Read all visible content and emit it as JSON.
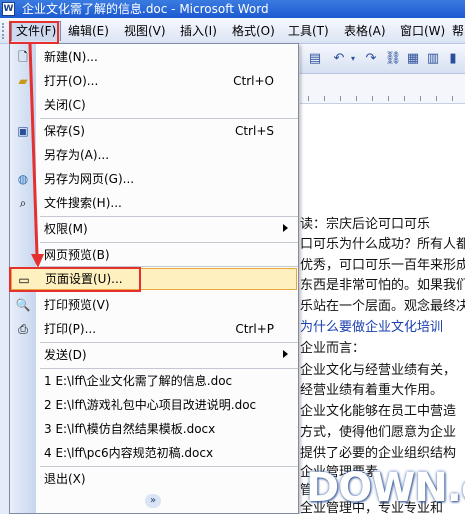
{
  "window": {
    "title": "企业文化需了解的信息.doc - Microsoft Word",
    "app_icon": "word-icon"
  },
  "menubar": [
    {
      "label": "文件(F)"
    },
    {
      "label": "编辑(E)"
    },
    {
      "label": "视图(V)"
    },
    {
      "label": "插入(I)"
    },
    {
      "label": "格式(O)"
    },
    {
      "label": "工具(T)"
    },
    {
      "label": "表格(A)"
    },
    {
      "label": "窗口(W)"
    },
    {
      "label": "帮"
    }
  ],
  "file_menu": {
    "items": [
      {
        "label": "新建(N)...",
        "shortcut": "",
        "icon": "new-doc-icon"
      },
      {
        "label": "打开(O)...",
        "shortcut": "Ctrl+O",
        "icon": "open-folder-icon"
      },
      {
        "label": "关闭(C)",
        "shortcut": "",
        "icon": ""
      },
      {
        "label": "保存(S)",
        "shortcut": "Ctrl+S",
        "icon": "save-icon"
      },
      {
        "label": "另存为(A)...",
        "shortcut": "",
        "icon": ""
      },
      {
        "label": "另存为网页(G)...",
        "shortcut": "",
        "icon": "web-page-icon"
      },
      {
        "label": "文件搜索(H)...",
        "shortcut": "",
        "icon": "file-search-icon"
      },
      {
        "label": "权限(M)",
        "shortcut": "",
        "icon": ""
      },
      {
        "label": "网页预览(B)",
        "shortcut": "",
        "icon": ""
      },
      {
        "label": "页面设置(U)...",
        "shortcut": "",
        "icon": "page-setup-icon"
      },
      {
        "label": "打印预览(V)",
        "shortcut": "",
        "icon": "print-preview-icon"
      },
      {
        "label": "打印(P)...",
        "shortcut": "Ctrl+P",
        "icon": "print-icon"
      },
      {
        "label": "发送(D)",
        "shortcut": "",
        "icon": ""
      },
      {
        "label": "1 E:\\lff\\企业文化需了解的信息.doc",
        "shortcut": "",
        "icon": ""
      },
      {
        "label": "2 E:\\lff\\游戏礼包中心项目改进说明.doc",
        "shortcut": "",
        "icon": ""
      },
      {
        "label": "3 E:\\lff\\模仿自然结果模板.docx",
        "shortcut": "",
        "icon": ""
      },
      {
        "label": "4 E:\\lff\\pc6内容规范初稿.docx",
        "shortcut": "",
        "icon": ""
      },
      {
        "label": "退出(X)",
        "shortcut": "",
        "icon": ""
      }
    ],
    "expand_glyph": "»"
  },
  "document": {
    "lines": [
      "读：宗庆后论可口可乐",
      "口可乐为什么成功？所有人都",
      "优秀，可口可乐一百年来形成",
      "东西是非常可怕的。如果我们",
      "乐站在一个层面。观念最终决",
      "  为什么要做企业文化培训",
      "企业而言：",
      "企业文化与经营业绩有关，",
      "经营业绩有着重大作用。",
      "企业文化能够在员工中营造",
      "方式，使得他们愿意为企业",
      "提供了必要的企业组织结构",
      "企业管理要素",
      "管",
      "全业管理中，专业专业和"
    ]
  },
  "watermark": {
    "text": "DOWN.cc"
  },
  "colors": {
    "titlebar": "#1c5ad1",
    "highlight": "#fff0c0",
    "annotation_red": "#e53030"
  }
}
